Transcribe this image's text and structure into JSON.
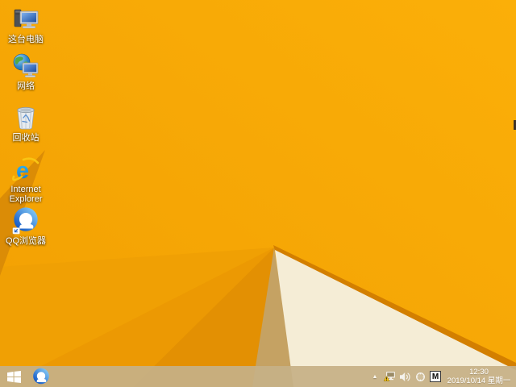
{
  "desktop": {
    "icons": [
      {
        "name": "this-pc",
        "label": "这台电脑"
      },
      {
        "name": "network",
        "label": "网络"
      },
      {
        "name": "recycle-bin",
        "label": "回收站"
      },
      {
        "name": "internet-explorer",
        "label": "Internet Explorer"
      },
      {
        "name": "qq-browser",
        "label": "QQ浏览器"
      }
    ]
  },
  "taskbar": {
    "tray": {
      "show_hidden_glyph": "▲",
      "ime_badge": "M",
      "clock": {
        "time": "12:30",
        "date": "2019/10/14 星期一"
      }
    }
  },
  "colors": {
    "wallpaper_base": "#F2A003",
    "wallpaper_bright": "#FBAF08",
    "wallpaper_left_facet": "#F0A004",
    "wallpaper_shadow_wedge": "#DB8C06",
    "wallpaper_fan_mid": "#EC9903",
    "wallpaper_fan_dark": "#E39003",
    "wallpaper_tan": "#C5A263",
    "wallpaper_cream": "#F5EDD6",
    "wallpaper_edge_band": "#D37F00",
    "taskbar_tint": "#C6B086"
  }
}
